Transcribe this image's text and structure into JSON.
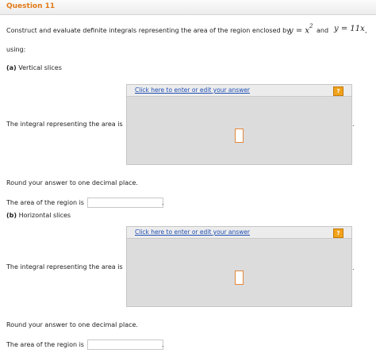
{
  "question": {
    "title": "Question 11"
  },
  "prompt": {
    "text": "Construct and evaluate definite integrals representing the area of the region enclosed by",
    "eq1": "y = x",
    "eq1_exp": "2",
    "and": "and",
    "eq2": "y = 11x",
    "comma": ",",
    "using": "using:"
  },
  "parts": [
    {
      "label": "(a)",
      "name": "Vertical slices",
      "editor_link": "Click here to enter or edit your answer",
      "help": "?",
      "integral_label": "The integral representing the area is",
      "round_note": "Round your answer to one decimal place.",
      "area_label": "The area of the region is",
      "area_value": ""
    },
    {
      "label": "(b)",
      "name": "Horizontal slices",
      "editor_link": "Click here to enter or edit your answer",
      "help": "?",
      "integral_label": "The integral representing the area is",
      "round_note": "Round your answer to one decimal place.",
      "area_label": "The area of the region is",
      "area_value": ""
    }
  ],
  "punctuation": {
    "period": "."
  }
}
